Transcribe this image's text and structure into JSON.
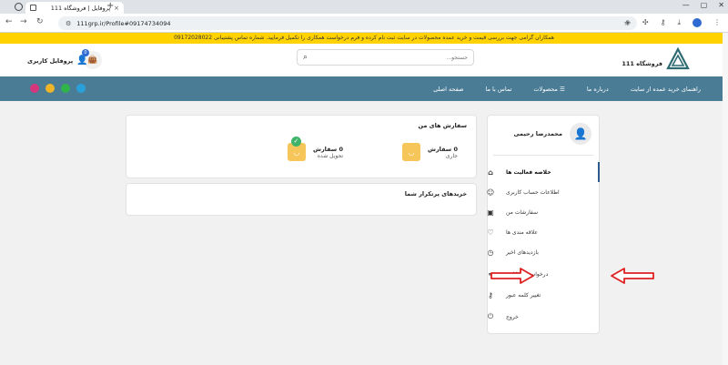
{
  "browser": {
    "tab_title": "پروفایل | فروشگاه 111",
    "url": "111grp.ir/Profile#09174734094",
    "new_tab": "+",
    "close": "×",
    "win_minimize": "—",
    "win_maximize": "▢",
    "win_close": "✕"
  },
  "announcement": "همکاران گرامی جهت بررسی قیمت و خرید عمده محصولات در سایت ثبت نام کرده و فرم درخواست همکاری را تکمیل فرمایید. شماره تماس پشتیبانی 09172028022",
  "header": {
    "store_name": "فروشگاه 111",
    "search_placeholder": "جستجو...",
    "cart_count": "0",
    "profile_label": "پروفایل کاربری"
  },
  "nav": {
    "items": [
      "صفحه اصلی",
      "تماس با ما",
      "محصولات",
      "درباره ما",
      "راهنمای خرید عمده از سایت"
    ]
  },
  "sidebar": {
    "user_name": "محمدرضا رحیمی",
    "items": [
      {
        "label": "خلاصه فعالیت ها",
        "icon": "home-icon",
        "active": true
      },
      {
        "label": "اطلاعات حساب کاربری",
        "icon": "user-icon",
        "active": false
      },
      {
        "label": "سفارشات من",
        "icon": "bag-icon",
        "active": false
      },
      {
        "label": "علاقه مندی ها",
        "icon": "heart-icon",
        "active": false
      },
      {
        "label": "بازدیدهای اخیر",
        "icon": "clock-icon",
        "active": false
      },
      {
        "label": "درخواست همکاری",
        "icon": "handshake-icon",
        "active": false
      },
      {
        "label": "تغییر کلمه عبور",
        "icon": "key-icon",
        "active": false
      },
      {
        "label": "خروج",
        "icon": "power-icon",
        "active": false
      }
    ]
  },
  "orders": {
    "title": "سفارش های من",
    "current": {
      "count": "0 سفارش",
      "label": "جاری"
    },
    "delivered": {
      "count": "0 سفارش",
      "label": "تحویل شده"
    }
  },
  "favorites": {
    "title": "خریدهای پرتکرار شما"
  },
  "colors": {
    "announcement_bg": "#ffd200",
    "navbar_bg": "#4b7c96",
    "accent": "#2e6ad1",
    "arrow": "#e02020"
  }
}
